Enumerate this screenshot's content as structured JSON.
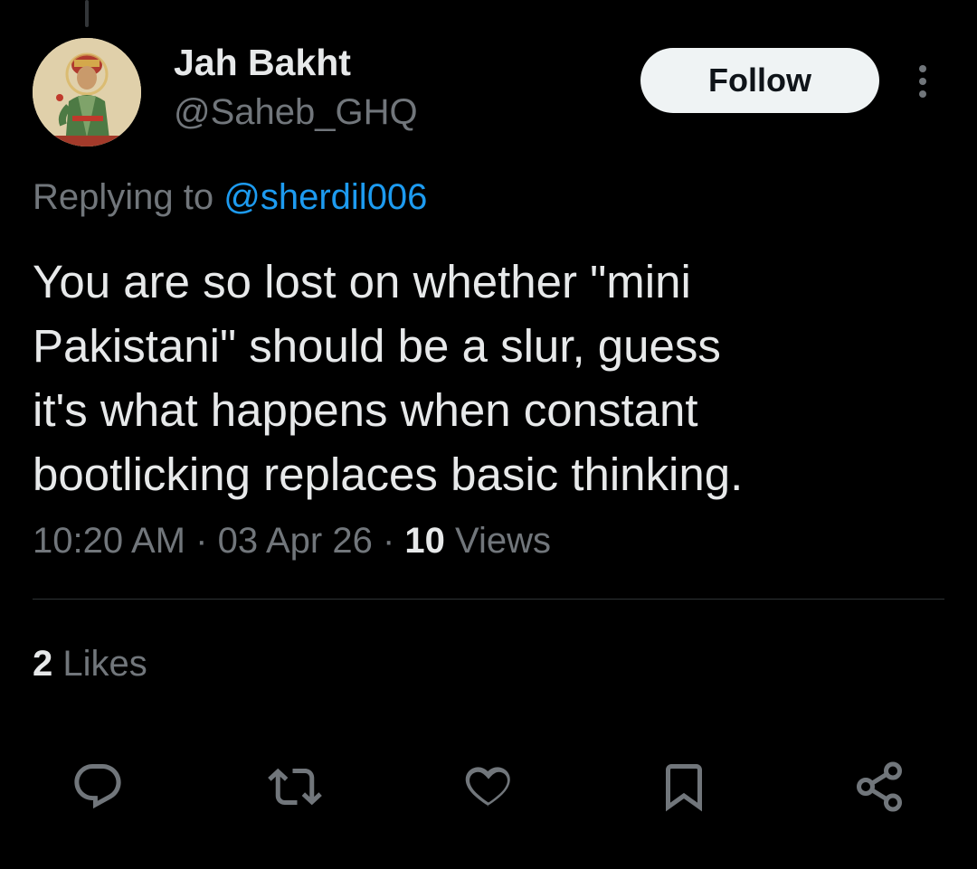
{
  "author": {
    "display_name": "Jah Bakht",
    "handle": "@Saheb_GHQ",
    "avatar_icon": "mughal-emperor-portrait"
  },
  "follow_label": "Follow",
  "more_icon": "more-vertical-icon",
  "reply_context": {
    "prefix": "Replying to",
    "mention": "@sherdil006"
  },
  "tweet": {
    "lines": [
      "You are so lost on whether \"mini",
      "Pakistani\" should be a slur, guess",
      "it's what happens when constant",
      "bootlicking replaces basic thinking."
    ]
  },
  "meta": {
    "time": "10:20 AM",
    "separator": "·",
    "date": "03 Apr 26",
    "views_count": "10",
    "views_label": "Views"
  },
  "likes": {
    "count": "2",
    "label": "Likes"
  },
  "actions": [
    "reply-icon",
    "retweet-icon",
    "like-icon",
    "bookmark-icon",
    "share-icon"
  ],
  "colors": {
    "background": "#000000",
    "text": "#e7e9ea",
    "muted": "#71767b",
    "link": "#1d9bf0",
    "button_bg": "#eff3f4"
  }
}
